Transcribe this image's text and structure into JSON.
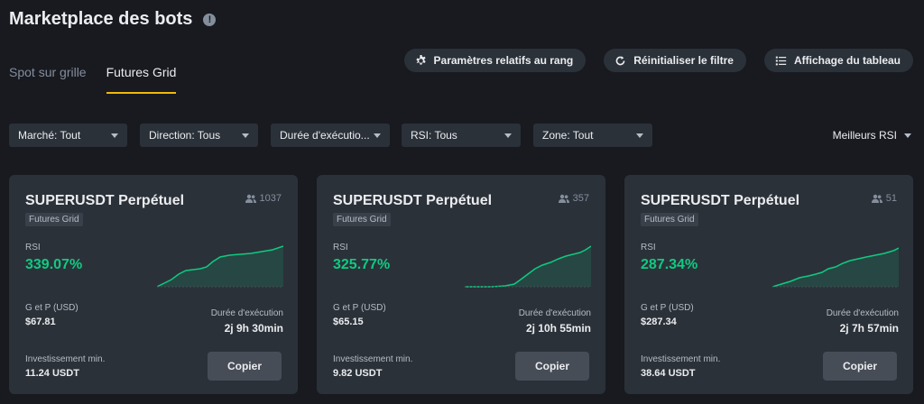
{
  "header": {
    "title": "Marketplace des bots",
    "info_icon": "info-icon"
  },
  "tabs": [
    {
      "label": "Spot sur grille",
      "active": false
    },
    {
      "label": "Futures Grid",
      "active": true
    }
  ],
  "actions": [
    {
      "label": "Paramètres relatifs au rang",
      "icon": "gear-icon"
    },
    {
      "label": "Réinitialiser le filtre",
      "icon": "refresh-icon"
    },
    {
      "label": "Affichage du tableau",
      "icon": "list-icon"
    }
  ],
  "filters": [
    {
      "label": "Marché: Tout"
    },
    {
      "label": "Direction: Tous"
    },
    {
      "label": "Durée d'exécutio..."
    },
    {
      "label": "RSI: Tous"
    },
    {
      "label": "Zone: Tout"
    }
  ],
  "sort": {
    "label": "Meilleurs RSI"
  },
  "labels": {
    "rsi": "RSI",
    "pnl": "G et P (USD)",
    "duration": "Durée d'exécution",
    "min_investment": "Investissement min.",
    "copy": "Copier"
  },
  "cards": [
    {
      "title": "SUPERUSDT Perpétuel",
      "tag": "Futures Grid",
      "users": "1037",
      "rsi": "339.07%",
      "pnl": "$67.81",
      "duration": "2j 9h 30min",
      "min_investment": "11.24 USDT"
    },
    {
      "title": "SUPERUSDT Perpétuel",
      "tag": "Futures Grid",
      "users": "357",
      "rsi": "325.77%",
      "pnl": "$65.15",
      "duration": "2j 10h 55min",
      "min_investment": "9.82 USDT"
    },
    {
      "title": "SUPERUSDT Perpétuel",
      "tag": "Futures Grid",
      "users": "51",
      "rsi": "287.34%",
      "pnl": "$287.34",
      "duration": "2j 7h 57min",
      "min_investment": "38.64 USDT"
    }
  ],
  "colors": {
    "accent": "#f0b90b",
    "positive": "#0ecb81",
    "background": "#181a20",
    "card": "#2b3139"
  }
}
